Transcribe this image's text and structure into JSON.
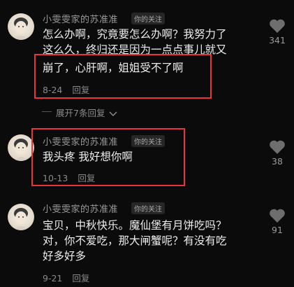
{
  "comments": [
    {
      "username": "小雯雯家的苏准准",
      "tag": "你的关注",
      "text_lines": [
        "怎么办啊，究竟要怎么办啊？我努力了",
        "这么久，终归还是因为一点点事儿就又",
        "崩了，心肝啊，姐姐受不了啊"
      ],
      "date": "8-24",
      "reply": "回复",
      "likes": "341"
    },
    {
      "username": "小雯雯家的苏准准",
      "tag": "你的关注",
      "text_lines": [
        "我头疼 我好想你啊"
      ],
      "date": "10-13",
      "reply": "回复",
      "likes": "38"
    },
    {
      "username": "小雯雯家的苏准准",
      "tag": "你的关注",
      "text_lines": [
        "宝贝，中秋快乐。魔仙堡有月饼吃吗？",
        "对，你不爱吃，那大闸蟹呢？有没有吃",
        "好多好多"
      ],
      "date": "9-21",
      "reply": "回复",
      "likes": "91"
    }
  ],
  "expand_replies": "展开7条回复",
  "highlight_color": "#e8343a"
}
